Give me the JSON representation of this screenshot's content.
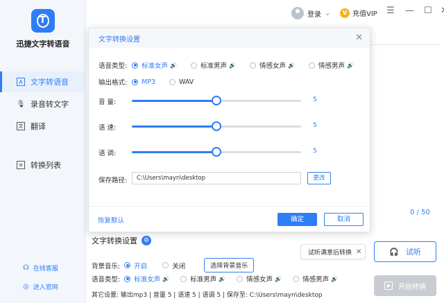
{
  "app": {
    "name": "迅捷文字转语音"
  },
  "sidebar": {
    "items": [
      {
        "label": "文字转语音",
        "icon": "text-to-speech-icon"
      },
      {
        "label": "录音转文字",
        "icon": "microphone-icon"
      },
      {
        "label": "翻译",
        "icon": "translate-icon"
      },
      {
        "label": "转换列表",
        "icon": "list-icon"
      }
    ],
    "support": "在线客服",
    "website": "进入官网"
  },
  "topbar": {
    "login": "登录",
    "vip": "充值VIP"
  },
  "panel": {
    "counter": "0 / 50"
  },
  "bottom": {
    "title": "文字转换设置",
    "bgm_label": "背景音乐:",
    "bgm_on": "开启",
    "bgm_off": "关闭",
    "bgm_button": "选择背景音乐",
    "voice_label": "语音类型:",
    "voices": [
      "标准女声",
      "标准男声",
      "情感女声",
      "情感男声"
    ],
    "other": "其它设置:  输出mp3  |  音量 5  |  语速 5  |  语调 5  |  保存至: C:\\Users\\mayn\\desktop",
    "tip": "试听满意后转换",
    "listen": "试听",
    "convert": "开始转换"
  },
  "modal": {
    "title": "文字转换设置",
    "voice_label": "语音类型:",
    "voices": [
      "标准女声",
      "标准男声",
      "情感女声",
      "情感男声"
    ],
    "format_label": "输出格式:",
    "formats": [
      "MP3",
      "WAV"
    ],
    "volume_label": "音    量:",
    "speed_label": "语    速:",
    "pitch_label": "语    调:",
    "volume": 5,
    "speed": 5,
    "pitch": 5,
    "level_fraction": 0.5,
    "path_label": "保存路径:",
    "path": "C:\\Users\\mayn\\desktop",
    "change": "更改",
    "reset": "恢复默认",
    "ok": "确定",
    "cancel": "取消"
  },
  "colors": {
    "accent": "#2f7df6",
    "disabled": "#c9ccd2"
  }
}
